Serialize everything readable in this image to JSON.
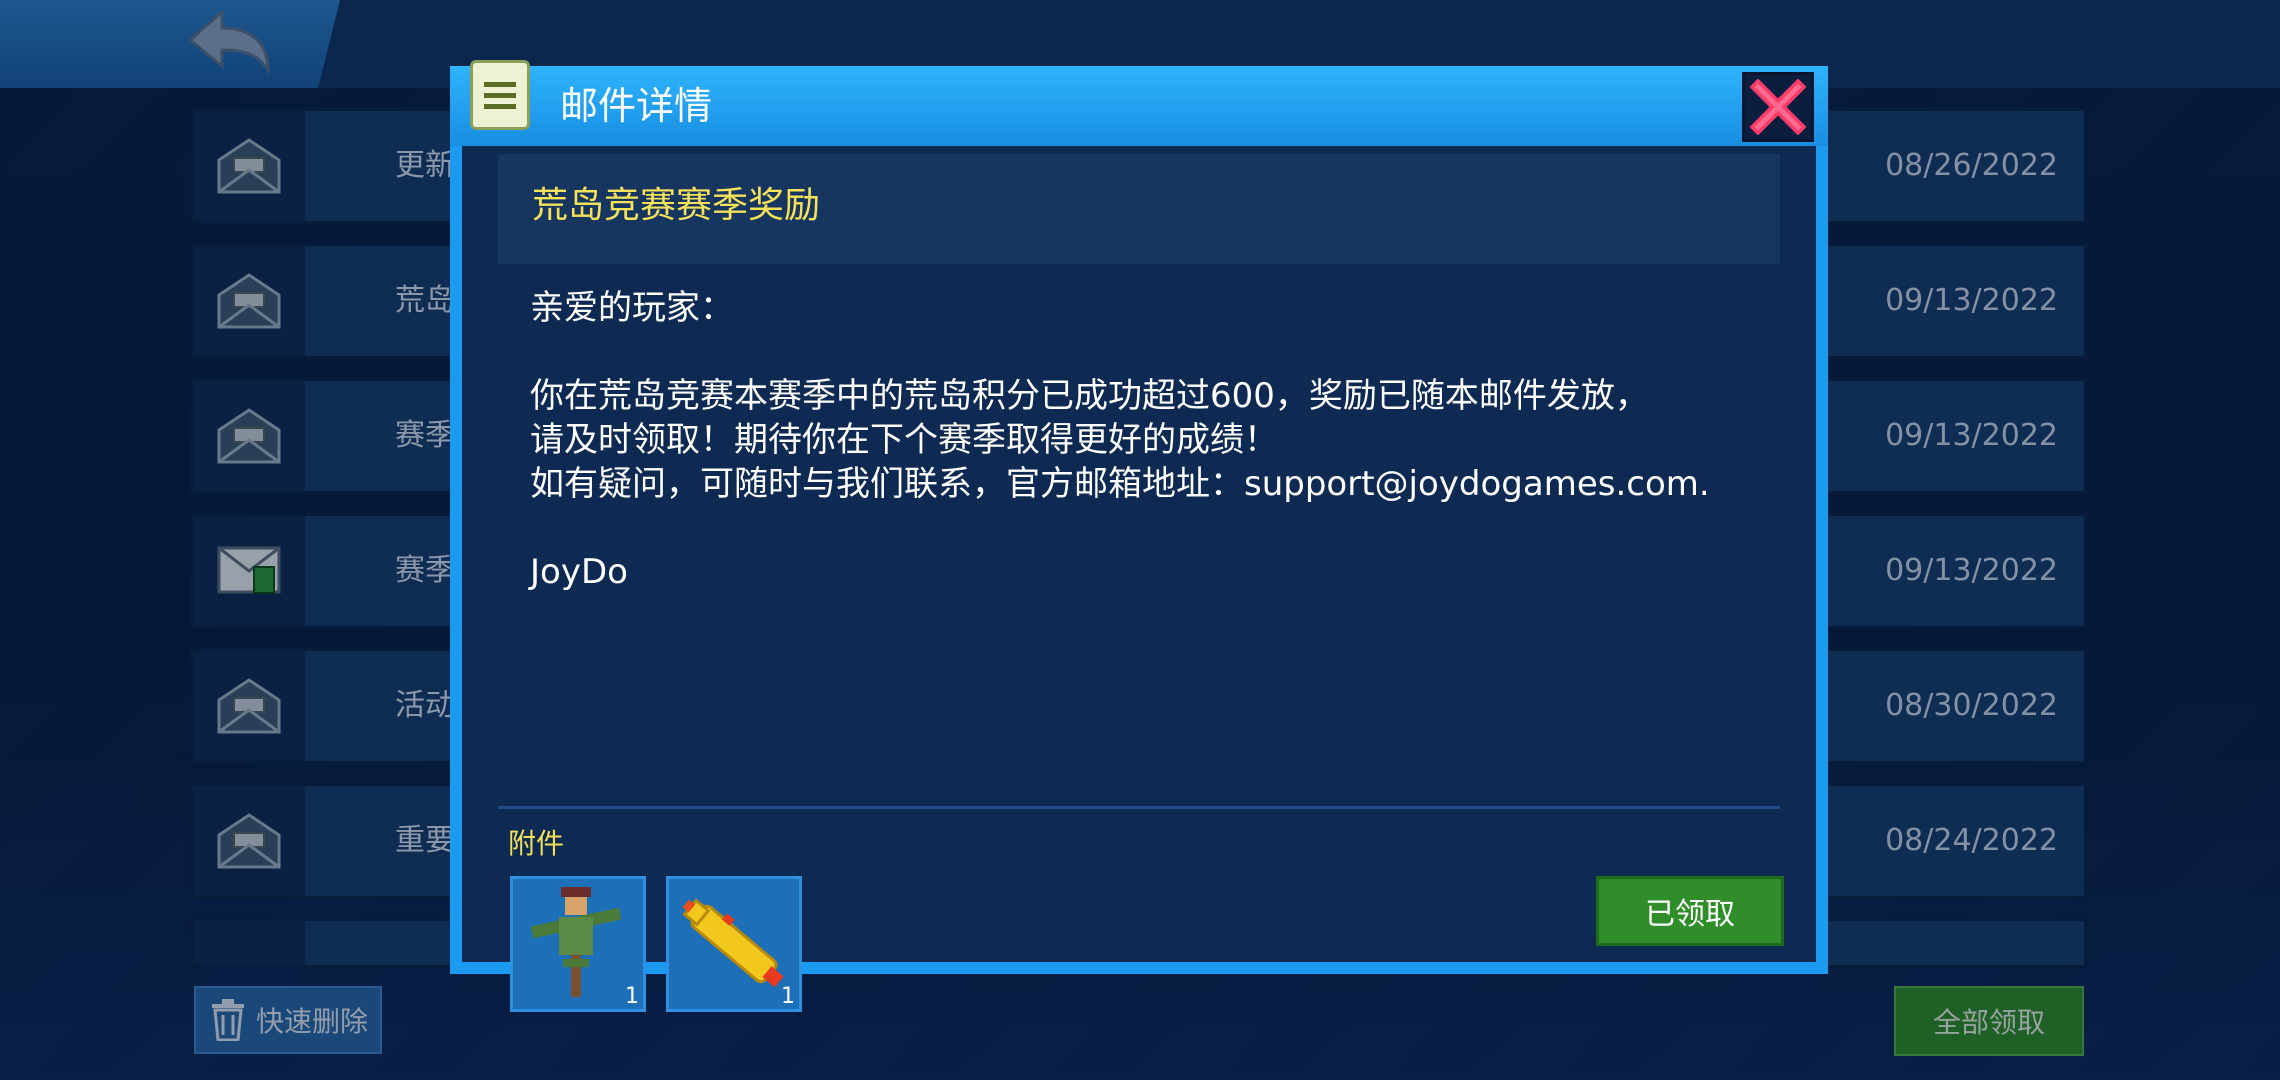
{
  "list": {
    "rows": [
      {
        "title": "更新",
        "date": "08/26/2022",
        "icon": "mail-opened-icon"
      },
      {
        "title": "荒岛",
        "date": "09/13/2022",
        "icon": "mail-opened-icon"
      },
      {
        "title": "赛季",
        "date": "09/13/2022",
        "icon": "mail-opened-icon"
      },
      {
        "title": "赛季",
        "date": "09/13/2022",
        "icon": "mail-attachment-icon"
      },
      {
        "title": "活动",
        "date": "08/30/2022",
        "icon": "mail-opened-icon"
      },
      {
        "title": "重要",
        "date": "08/24/2022",
        "icon": "mail-opened-icon"
      }
    ]
  },
  "footer": {
    "quick_delete": "快速删除",
    "claim_all": "全部领取"
  },
  "modal": {
    "title": "邮件详情",
    "subject": "荒岛竞赛赛季奖励",
    "greeting": "亲爱的玩家：",
    "body_line1": "你在荒岛竞赛本赛季中的荒岛积分已成功超过600，奖励已随本邮件发放，",
    "body_line2": "请及时领取！期待你在下个赛季取得更好的成绩！",
    "body_line3": "如有疑问，可随时与我们联系，官方邮箱地址：support@joydogames.com.",
    "signature": "JoyDo",
    "attachments_label": "附件",
    "attachments": [
      {
        "name": "scarecrow-item",
        "count": "1"
      },
      {
        "name": "rubber-chicken-item",
        "count": "1"
      }
    ],
    "claimed_label": "已领取"
  },
  "colors": {
    "modal_border": "#1a9bf0",
    "subject_text": "#f6e35a",
    "claim_green": "#2f8e2a"
  }
}
